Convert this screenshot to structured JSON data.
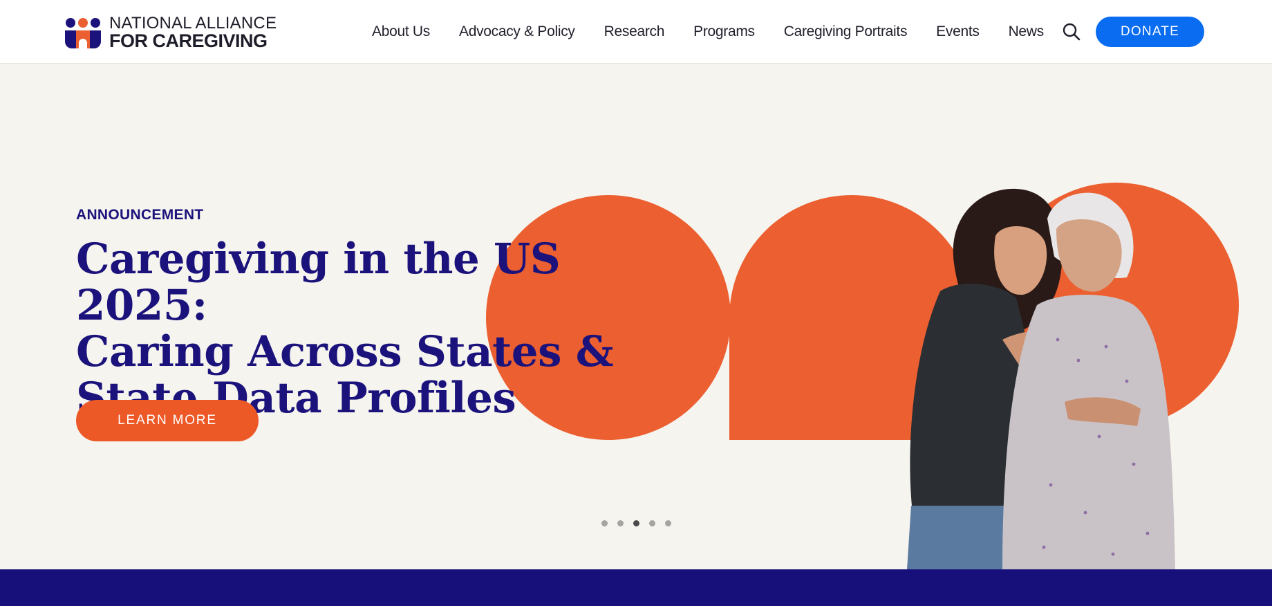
{
  "header": {
    "logo": {
      "line1": "NATIONAL ALLIANCE",
      "line2": "FOR CAREGIVING"
    },
    "nav": [
      {
        "label": "About Us"
      },
      {
        "label": "Advocacy & Policy"
      },
      {
        "label": "Research"
      },
      {
        "label": "Programs"
      },
      {
        "label": "Caregiving Portraits"
      },
      {
        "label": "Events"
      },
      {
        "label": "News"
      }
    ],
    "search_icon": "search-icon",
    "donate_label": "DONATE"
  },
  "hero": {
    "eyebrow": "ANNOUNCEMENT",
    "headline_line1": "Caregiving in the US 2025:",
    "headline_line2": "Caring Across States &",
    "headline_line3": "State Data Profiles",
    "cta_label": "LEARN MORE",
    "carousel": {
      "slide_count": 5,
      "active_index": 2
    }
  },
  "colors": {
    "brand_navy": "#1b137b",
    "accent_orange": "#ec5f30",
    "donate_blue": "#0a6cf0",
    "background": "#f6f4ef"
  }
}
